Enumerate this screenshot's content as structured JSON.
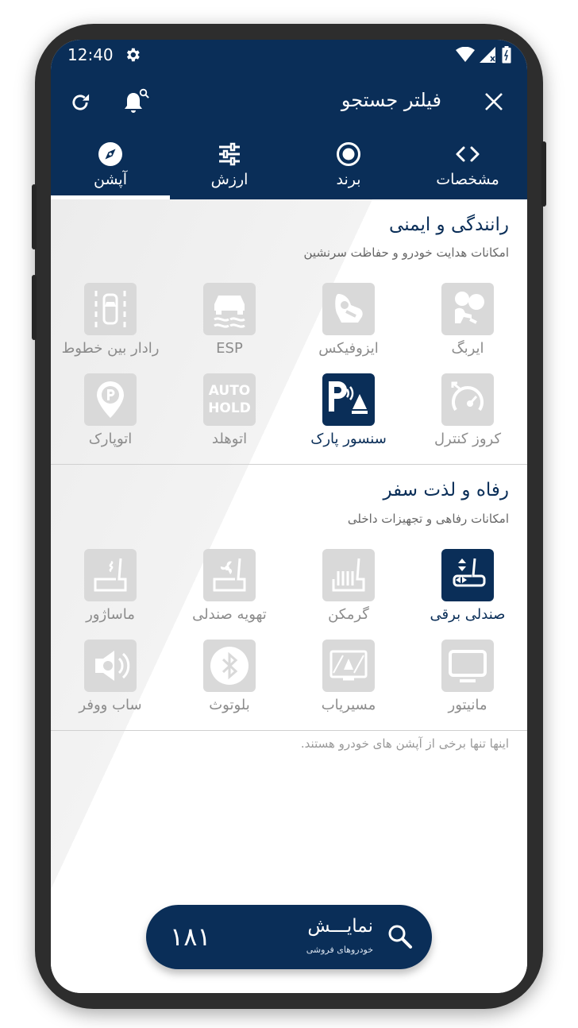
{
  "status_bar": {
    "time": "12:40"
  },
  "header": {
    "title": "فیلتر جستجو"
  },
  "tabs": [
    {
      "label": "آپشن",
      "icon": "compass-icon",
      "active": true
    },
    {
      "label": "ارزش",
      "icon": "sliders-icon",
      "active": false
    },
    {
      "label": "برند",
      "icon": "radio-target-icon",
      "active": false
    },
    {
      "label": "مشخصات",
      "icon": "code-brackets-icon",
      "active": false
    }
  ],
  "sections": [
    {
      "title": "رانندگی و ایمنی",
      "subtitle": "امکانات هدایت خودرو و حفاظت سرنشین",
      "options": [
        {
          "label": "ایربگ",
          "icon": "airbag-icon",
          "selected": false
        },
        {
          "label": "ایزوفیکس",
          "icon": "isofix-icon",
          "selected": false
        },
        {
          "label": "ESP",
          "icon": "esp-icon",
          "selected": false
        },
        {
          "label": "رادار بین خطوط",
          "icon": "lane-radar-icon",
          "selected": false
        },
        {
          "label": "کروز کنترل",
          "icon": "cruise-control-icon",
          "selected": false
        },
        {
          "label": "سنسور پارک",
          "icon": "park-sensor-icon",
          "selected": true
        },
        {
          "label": "اتوهلد",
          "icon": "auto-hold-icon",
          "icon_text_top": "AUTO",
          "icon_text_bottom": "HOLD",
          "selected": false
        },
        {
          "label": "اتوپارک",
          "icon": "auto-park-icon",
          "selected": false
        }
      ]
    },
    {
      "title": "رفاه و لذت سفر",
      "subtitle": "امکانات رفاهی و تجهیزات داخلی",
      "options": [
        {
          "label": "صندلی برقی",
          "icon": "power-seat-icon",
          "selected": true
        },
        {
          "label": "گرمکن",
          "icon": "seat-heater-icon",
          "selected": false
        },
        {
          "label": "تهویه صندلی",
          "icon": "seat-ventilation-icon",
          "selected": false
        },
        {
          "label": "ماساژور",
          "icon": "seat-massage-icon",
          "selected": false
        },
        {
          "label": "مانیتور",
          "icon": "monitor-icon",
          "selected": false
        },
        {
          "label": "مسیریاب",
          "icon": "navigation-icon",
          "selected": false
        },
        {
          "label": "بلوتوث",
          "icon": "bluetooth-icon",
          "selected": false
        },
        {
          "label": "ساب ووفر",
          "icon": "subwoofer-icon",
          "selected": false
        }
      ]
    }
  ],
  "note": "اینها تنها برخی از آپشن های خودرو هستند.",
  "show_button": {
    "label": "نمایـــش",
    "sublabel": "خودروهای فروشی",
    "count": "۱۸۱"
  },
  "colors": {
    "primary": "#0a2e58",
    "inactive_icon_bg": "#d9d9d9",
    "inactive_text": "#8c8c8c"
  }
}
